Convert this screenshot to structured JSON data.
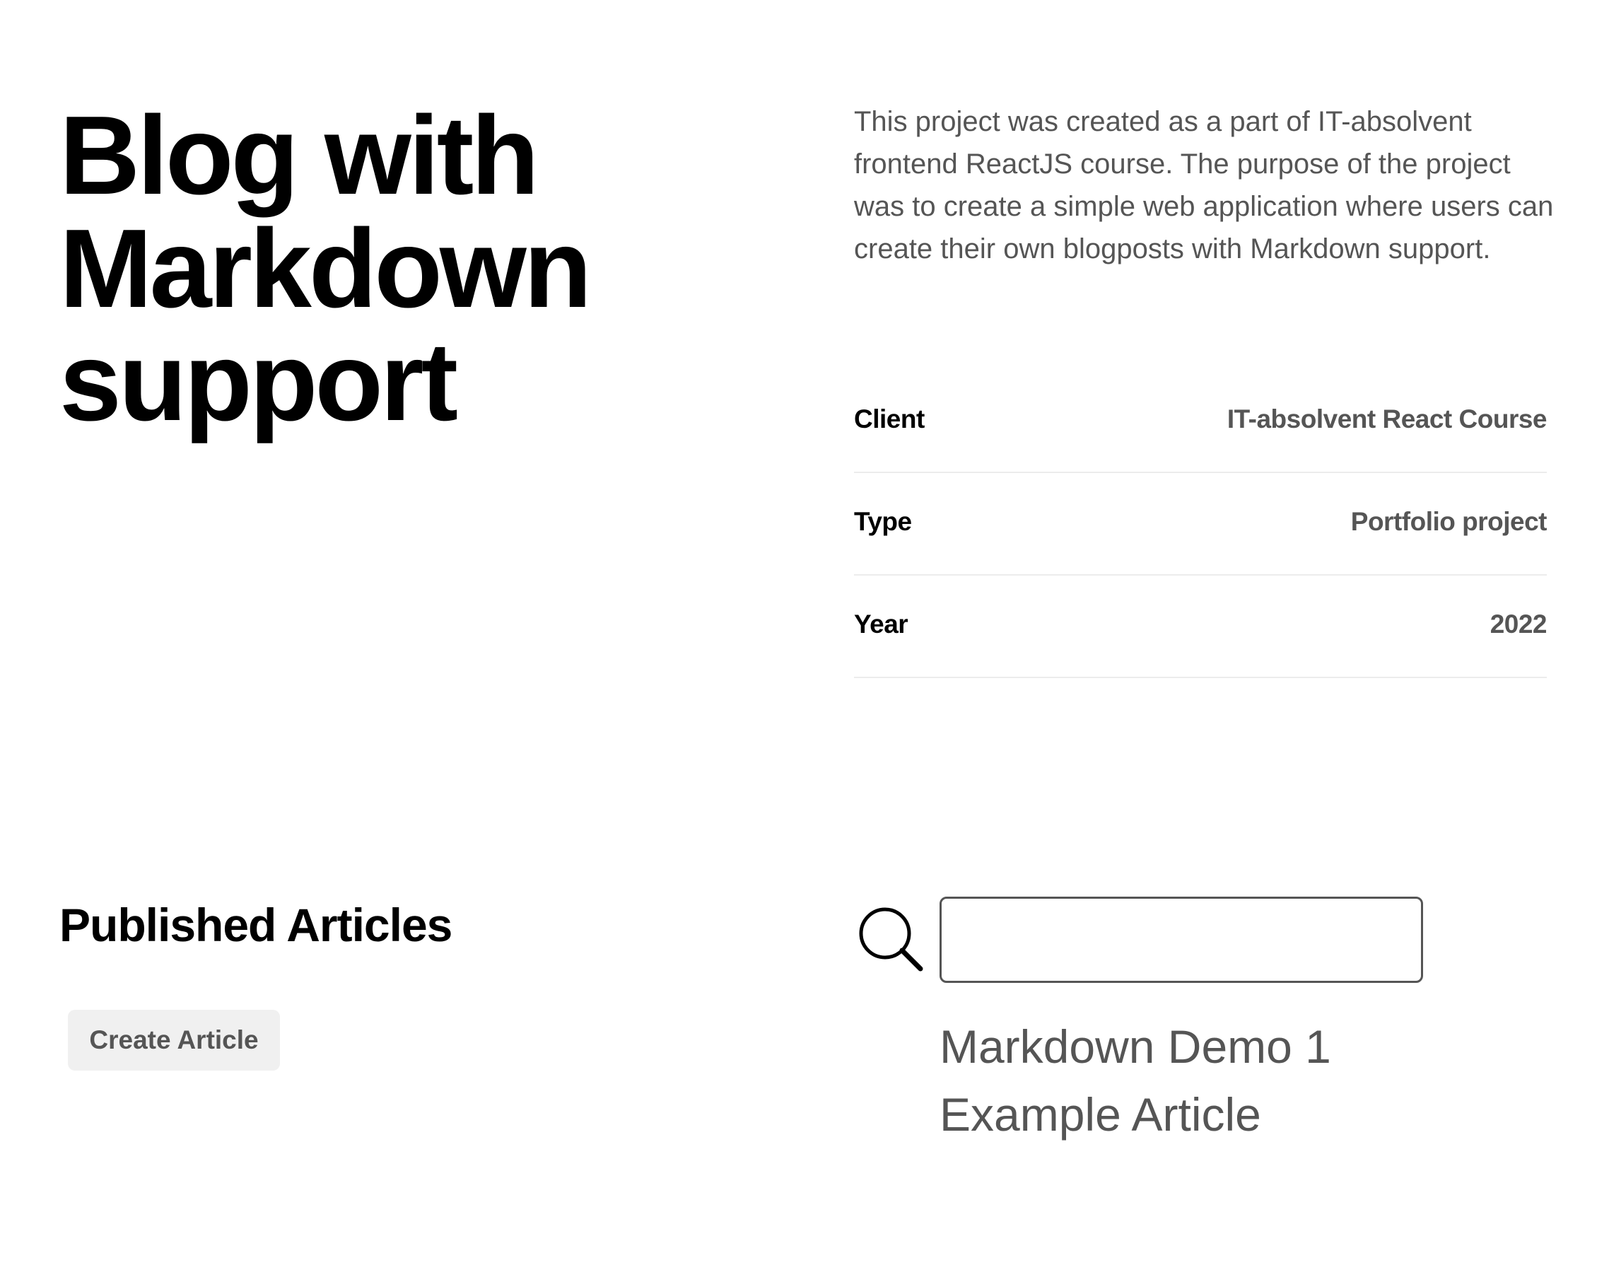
{
  "project": {
    "title": "Blog with Markdown support",
    "description": "This project was created as a part of IT-absolvent frontend ReactJS course. The purpose of the project was to create a simple web application where users can create their own blogposts with Markdown support.",
    "details": [
      {
        "key": "Client",
        "value": "IT-absolvent React Course"
      },
      {
        "key": "Type",
        "value": "Portfolio project"
      },
      {
        "key": "Year",
        "value": "2022"
      }
    ]
  },
  "articles": {
    "heading": "Published Articles",
    "create_label": "Create Article",
    "search": {
      "value": "",
      "icon": "search-icon"
    },
    "items": [
      "Markdown Demo 1",
      "Example Article"
    ]
  }
}
